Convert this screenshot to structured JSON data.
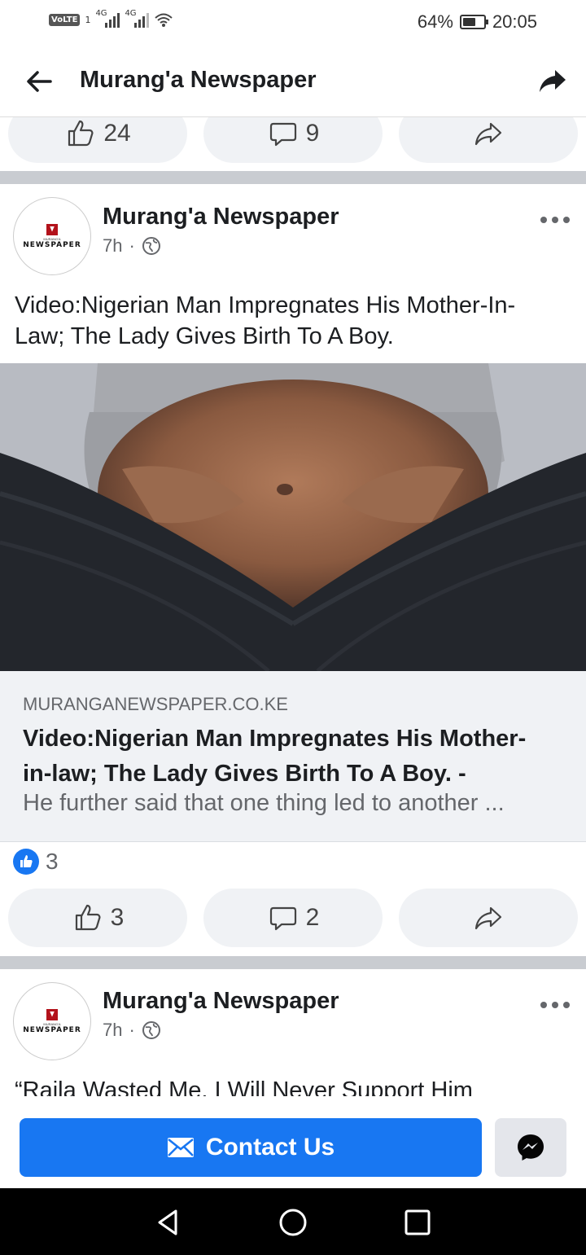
{
  "status_bar": {
    "volte": "VoLTE",
    "sim": "1",
    "net1": "4G",
    "net2": "4G",
    "battery": "64%",
    "battery_level": 0.64,
    "time": "20:05"
  },
  "header": {
    "title": "Murang'a Newspaper",
    "icons": [
      "back-arrow-icon",
      "share-icon"
    ]
  },
  "prev_post_actions": {
    "like_count": "24",
    "comment_count": "9"
  },
  "post1": {
    "author": "Murang'a Newspaper",
    "time": "7h",
    "separator": "·",
    "avatar_text": "NEWSPAPER",
    "avatar_small": "MURANG'A",
    "text_line1": "Video:Nigerian Man Impregnates His Mother-In-",
    "text_line2": "Law; The Lady Gives Birth To A Boy.",
    "link": {
      "domain": "MURANGANEWSPAPER.CO.KE",
      "title_line1": "Video:Nigerian Man Impregnates His Mother-",
      "title_line2": "in-law; The Lady Gives Birth To A Boy. -",
      "description": "He further said that one thing led to another ..."
    },
    "reaction_count": "3",
    "like_count": "3",
    "comment_count": "2"
  },
  "post2": {
    "author": "Murang'a Newspaper",
    "time": "7h",
    "separator": "·",
    "avatar_text": "NEWSPAPER",
    "avatar_small": "MURANG'A",
    "text_line1": "“Raila Wasted Me, I Will Never Support Him"
  },
  "cta": {
    "contact_label": "Contact Us"
  },
  "colors": {
    "brand_blue": "#1877f2",
    "pill_bg": "#f0f2f5",
    "divider": "#c9ccd1"
  }
}
